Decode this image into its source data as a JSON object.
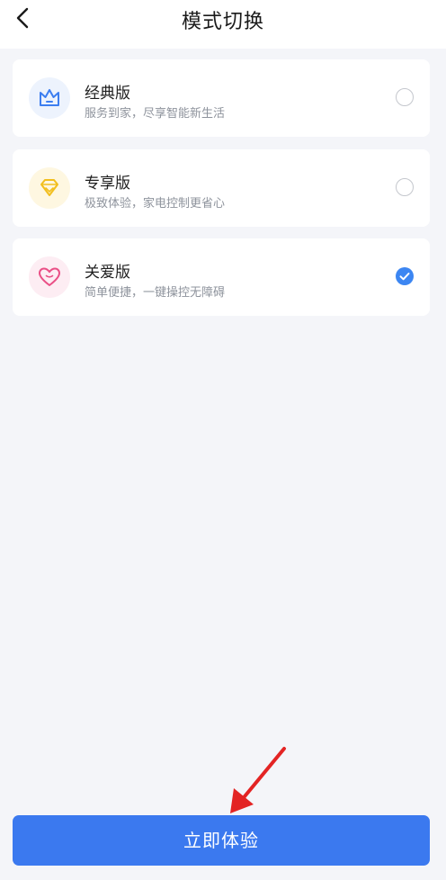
{
  "header": {
    "title": "模式切换",
    "back_icon": "chevron-left-icon"
  },
  "modes": [
    {
      "name": "经典版",
      "desc": "服务到家，尽享智能新生活",
      "icon": "crown-icon",
      "icon_color": "#3c7ef0",
      "icon_bg": "#edf3fd",
      "selected": false
    },
    {
      "name": "专享版",
      "desc": "极致体验，家电控制更省心",
      "icon": "diamond-icon",
      "icon_color": "#f2bf1f",
      "icon_bg": "#fef7e1",
      "selected": false
    },
    {
      "name": "关爱版",
      "desc": "简单便捷，一键操控无障碍",
      "icon": "heart-icon",
      "icon_color": "#ea4f86",
      "icon_bg": "#fdedf3",
      "selected": true
    }
  ],
  "cta": {
    "label": "立即体验",
    "color": "#3b79ef"
  },
  "colors": {
    "background": "#f4f5f9",
    "radio_checked": "#3c86f2",
    "annotation_arrow": "#e32424"
  }
}
